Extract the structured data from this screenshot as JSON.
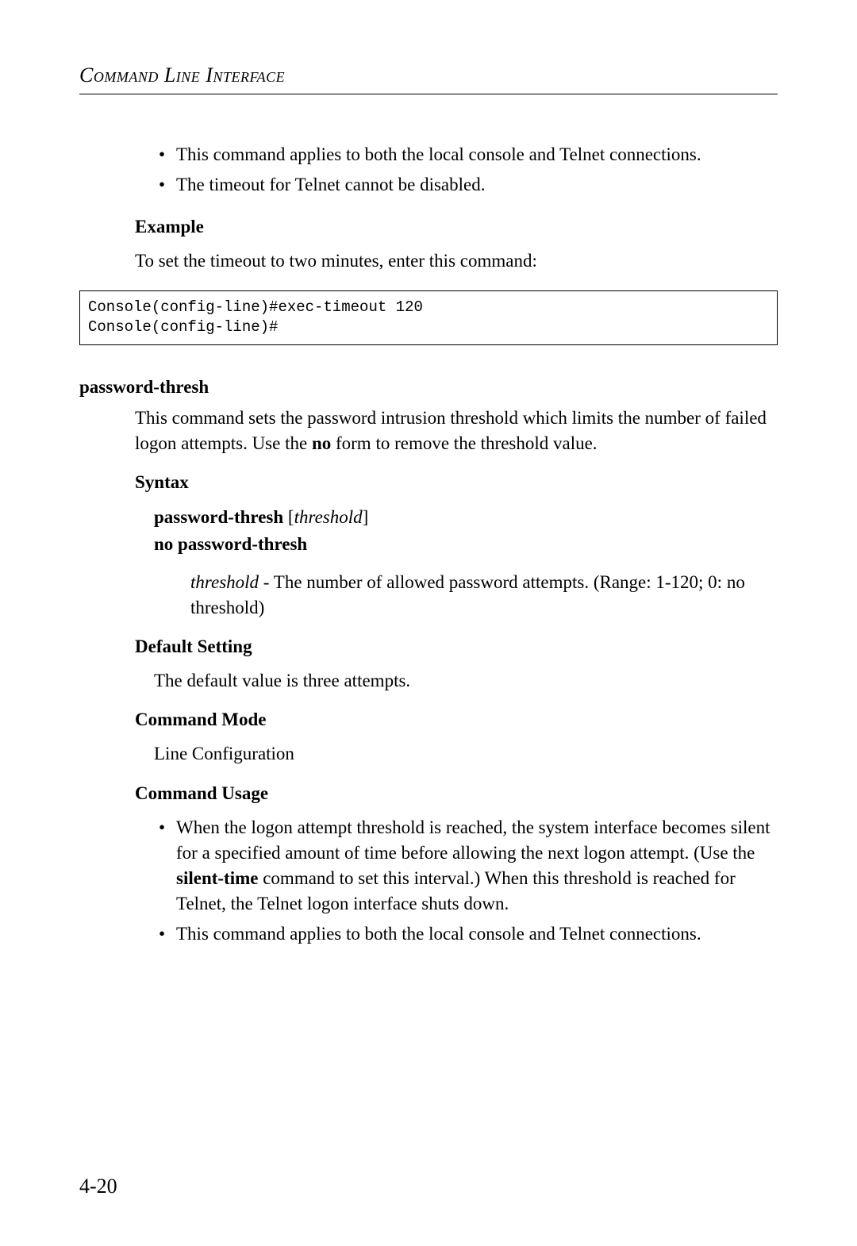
{
  "header": {
    "title": "Command Line Interface"
  },
  "top_bullets": [
    "This command applies to both the local console and Telnet connections.",
    "The timeout for Telnet cannot be disabled."
  ],
  "example": {
    "heading": "Example",
    "intro": "To set the timeout to two minutes, enter this command:",
    "code": "Console(config-line)#exec-timeout 120\nConsole(config-line)#"
  },
  "command": {
    "name": "password-thresh",
    "description_parts": {
      "pre": "This command sets the password intrusion threshold which limits the number of failed logon attempts. Use the ",
      "bold": "no",
      "post": " form to remove the threshold value."
    },
    "syntax": {
      "heading": "Syntax",
      "line1_bold": "password-thresh",
      "line1_bracket_open": " [",
      "line1_italic": "threshold",
      "line1_bracket_close": "]",
      "line2_bold": "no password-thresh",
      "param_italic": "threshold",
      "param_text": " - The number of allowed password attempts. (Range: 1-120; 0: no threshold)"
    },
    "default_setting": {
      "heading": "Default Setting",
      "text": "The default value is three attempts."
    },
    "command_mode": {
      "heading": "Command Mode",
      "text": "Line Configuration"
    },
    "command_usage": {
      "heading": "Command Usage",
      "bullet1_pre": "When the logon attempt threshold is reached, the system interface becomes silent for a specified amount of time before allowing the next logon attempt. (Use the ",
      "bullet1_bold": "silent-time",
      "bullet1_post": " command to set this interval.) When this threshold is reached for Telnet, the Telnet logon interface shuts down.",
      "bullet2": "This command applies to both the local console and Telnet connections."
    }
  },
  "page_number": "4-20"
}
